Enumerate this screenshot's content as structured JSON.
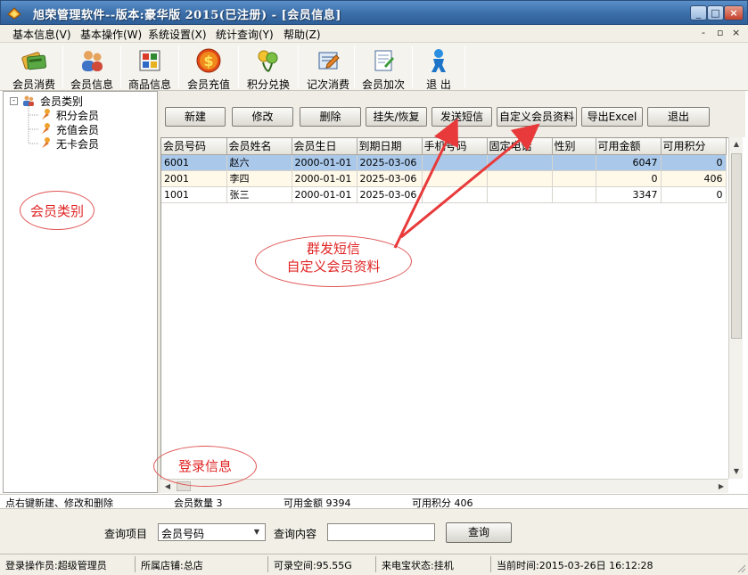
{
  "window": {
    "title": "旭荣管理软件--版本:豪华版 2015(已注册) - [会员信息]",
    "controls": {
      "minimize": "_",
      "maximize": "□",
      "close": "×"
    }
  },
  "menubar": {
    "items": [
      {
        "label": "基本信息(V)"
      },
      {
        "label": "基本操作(W)"
      },
      {
        "label": "系统设置(X)"
      },
      {
        "label": "统计查询(Y)"
      },
      {
        "label": "帮助(Z)"
      }
    ],
    "mdi": {
      "minimize": "-",
      "restore": "▫",
      "close": "×"
    }
  },
  "toolbar": {
    "items": [
      {
        "label": "会员消费",
        "icon": "member-consume-icon"
      },
      {
        "label": "会员信息",
        "icon": "member-info-icon"
      },
      {
        "label": "商品信息",
        "icon": "product-info-icon"
      },
      {
        "label": "会员充值",
        "icon": "recharge-icon"
      },
      {
        "label": "积分兑换",
        "icon": "points-exchange-icon"
      },
      {
        "label": "记次消费",
        "icon": "count-consume-icon"
      },
      {
        "label": "会员加次",
        "icon": "add-count-icon"
      },
      {
        "label": "退 出",
        "icon": "exit-icon"
      }
    ]
  },
  "tree": {
    "root": {
      "label": "会员类别",
      "expander": "-"
    },
    "children": [
      {
        "label": "积分会员"
      },
      {
        "label": "充值会员"
      },
      {
        "label": "无卡会员"
      }
    ]
  },
  "actions": {
    "buttons": [
      {
        "label": "新建"
      },
      {
        "label": "修改"
      },
      {
        "label": "删除"
      },
      {
        "label": "挂失/恢复"
      },
      {
        "label": "发送短信"
      },
      {
        "label": "自定义会员资料"
      },
      {
        "label": "导出Excel"
      },
      {
        "label": "退出"
      }
    ]
  },
  "grid": {
    "columns": [
      "会员号码",
      "会员姓名",
      "会员生日",
      "到期日期",
      "手机号码",
      "固定电话",
      "性别",
      "可用金额",
      "可用积分"
    ],
    "rows": [
      {
        "id": "6001",
        "name": "赵六",
        "birthday": "2000-01-01",
        "expiry": "2025-03-06",
        "mobile": "",
        "phone": "",
        "gender": "",
        "balance": "6047",
        "points": "0"
      },
      {
        "id": "2001",
        "name": "李四",
        "birthday": "2000-01-01",
        "expiry": "2025-03-06",
        "mobile": "",
        "phone": "",
        "gender": "",
        "balance": "0",
        "points": "406"
      },
      {
        "id": "1001",
        "name": "张三",
        "birthday": "2000-01-01",
        "expiry": "2025-03-06",
        "mobile": "",
        "phone": "",
        "gender": "",
        "balance": "3347",
        "points": "0"
      }
    ]
  },
  "summary": {
    "hint": "点右键新建、修改和删除",
    "member_count": "会员数量 3",
    "total_balance": "可用金额 9394",
    "total_points": "可用积分 406"
  },
  "query": {
    "item_label": "查询项目",
    "item_value": "会员号码",
    "content_label": "查询内容",
    "content_value": "",
    "button": "查询"
  },
  "status": {
    "operator": "登录操作员:超级管理员",
    "store": "所属店铺:总店",
    "space": "可录空间:95.55G",
    "sms": "来电宝状态:挂机",
    "time": "当前时间:2015-03-26日 16:12:28"
  },
  "annotations": {
    "member_category": "会员类别",
    "sms_line1": "群发短信",
    "sms_line2": "自定义会员资料",
    "login_info": "登录信息",
    "color": "#e02424"
  }
}
